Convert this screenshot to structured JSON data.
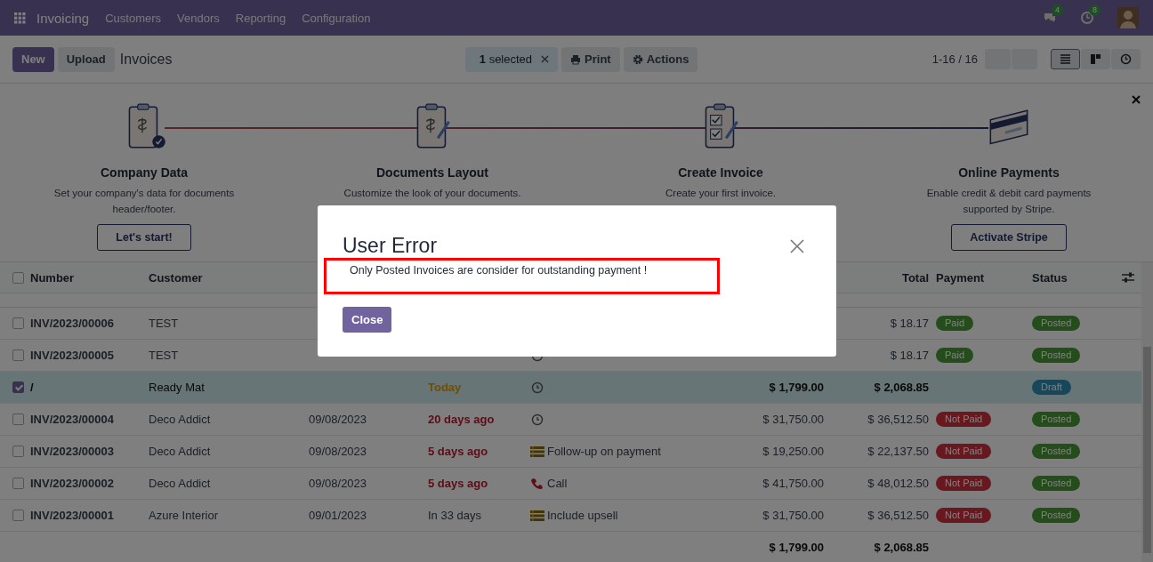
{
  "navbar": {
    "app_name": "Invoicing",
    "menu": [
      "Customers",
      "Vendors",
      "Reporting",
      "Configuration"
    ],
    "systray": [
      {
        "kind": "messages",
        "count": "4"
      },
      {
        "kind": "activities",
        "count": "8"
      }
    ]
  },
  "control_panel": {
    "buttons": [
      {
        "label": "New",
        "kind": "primary"
      },
      {
        "label": "Upload",
        "kind": "secondary"
      }
    ],
    "breadcrumb": "Invoices",
    "selection": "**1** selected",
    "actions": [
      {
        "label": "Print",
        "kind": "print"
      },
      {
        "label": "Actions",
        "kind": "gear"
      }
    ],
    "pager": "1-16 / 16",
    "views": [
      {
        "kind": "list",
        "selected": true
      },
      {
        "kind": "kanban",
        "selected": false
      },
      {
        "kind": "activity",
        "selected": false
      }
    ]
  },
  "onboarding": {
    "steps": [
      {
        "kind": "company",
        "done": true,
        "title": "Company Data",
        "description": "Set your company's data for documents header/footer.",
        "button": "Let's start!"
      },
      {
        "kind": "layout",
        "done": false,
        "title": "Documents Layout",
        "description": "Customize the look of your documents."
      },
      {
        "kind": "invoice",
        "done": false,
        "title": "Create Invoice",
        "description": "Create your first invoice."
      },
      {
        "kind": "payment",
        "done": false,
        "title": "Online Payments",
        "description": "Enable credit & debit card payments supported by Stripe.",
        "button": "Activate Stripe"
      }
    ]
  },
  "table": {
    "select_all": false,
    "columns": {
      "number": "Number",
      "customer": "Customer",
      "total": "Total",
      "payment": "Payment",
      "status": "Status"
    },
    "rows": [
      {
        "selected": false,
        "number": "INV/2023/00006",
        "customer": "TEST",
        "total": "$ 18.17",
        "payment": {
          "label": "Paid",
          "kind": "paid"
        },
        "status": {
          "label": "Posted",
          "kind": "posted"
        }
      },
      {
        "selected": false,
        "number": "INV/2023/00005",
        "customer": "TEST",
        "activity": {
          "kind": "clock"
        },
        "total": "$ 18.17",
        "payment": {
          "label": "Paid",
          "kind": "paid"
        },
        "status": {
          "label": "Posted",
          "kind": "posted"
        }
      },
      {
        "selected": true,
        "number": "/",
        "customer": "Ready Mat",
        "due": {
          "label": "Today",
          "kind": "today"
        },
        "activity": {
          "kind": "clock"
        },
        "untaxed": "$ 1,799.00",
        "total": "$ 2,068.85",
        "status": {
          "label": "Draft",
          "kind": "draft"
        }
      },
      {
        "selected": false,
        "number": "INV/2023/00004",
        "customer": "Deco Addict",
        "date": "09/08/2023",
        "due": {
          "label": "20 days ago",
          "kind": "overdue"
        },
        "activity": {
          "kind": "clock"
        },
        "untaxed": "$ 31,750.00",
        "total": "$ 36,512.50",
        "payment": {
          "label": "Not Paid",
          "kind": "not_paid"
        },
        "status": {
          "label": "Posted",
          "kind": "posted"
        }
      },
      {
        "selected": false,
        "number": "INV/2023/00003",
        "customer": "Deco Addict",
        "date": "09/08/2023",
        "due": {
          "label": "5 days ago",
          "kind": "overdue"
        },
        "activity": {
          "kind": "list",
          "label": "Follow-up on payment"
        },
        "untaxed": "$ 19,250.00",
        "total": "$ 22,137.50",
        "payment": {
          "label": "Not Paid",
          "kind": "not_paid"
        },
        "status": {
          "label": "Posted",
          "kind": "posted"
        }
      },
      {
        "selected": false,
        "number": "INV/2023/00002",
        "customer": "Deco Addict",
        "date": "09/08/2023",
        "due": {
          "label": "5 days ago",
          "kind": "overdue"
        },
        "activity": {
          "kind": "phone",
          "label": "Call"
        },
        "untaxed": "$ 41,750.00",
        "total": "$ 48,012.50",
        "payment": {
          "label": "Not Paid",
          "kind": "not_paid"
        },
        "status": {
          "label": "Posted",
          "kind": "posted"
        }
      },
      {
        "selected": false,
        "number": "INV/2023/00001",
        "customer": "Azure Interior",
        "date": "09/01/2023",
        "due": {
          "label": "In 33 days",
          "kind": "future"
        },
        "activity": {
          "kind": "list",
          "label": "Include upsell"
        },
        "untaxed": "$ 31,750.00",
        "total": "$ 36,512.50",
        "payment": {
          "label": "Not Paid",
          "kind": "not_paid"
        },
        "status": {
          "label": "Posted",
          "kind": "posted"
        }
      }
    ],
    "footer": {
      "untaxed": "$ 1,799.00",
      "total": "$ 2,068.85"
    }
  },
  "dialog": {
    "title": "User Error",
    "message": "Only Posted Invoices are consider for outstanding payment !",
    "highlighted": true,
    "button": "Close"
  }
}
